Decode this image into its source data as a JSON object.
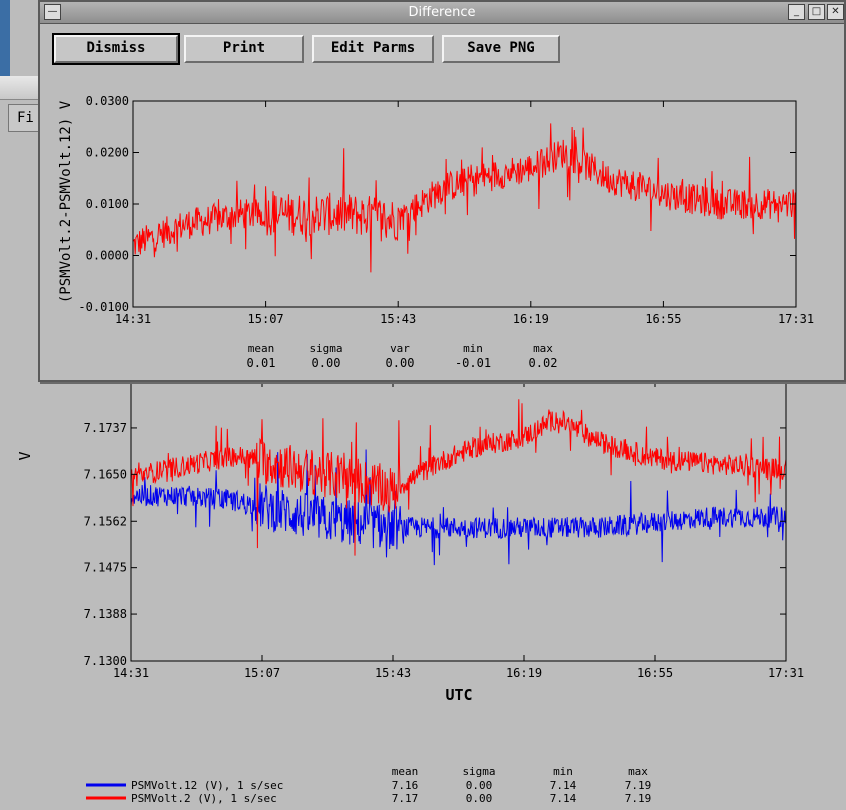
{
  "window": {
    "title": "Difference"
  },
  "background_window": {
    "menu_label": "Fi"
  },
  "toolbar": {
    "dismiss_label": "Dismiss",
    "print_label": "Print",
    "edit_parms_label": "Edit Parms",
    "save_png_label": "Save PNG"
  },
  "diff_plot": {
    "ylabel": "(PSMVolt.2-PSMVolt.12) V",
    "stats_headers": [
      "mean",
      "sigma",
      "var",
      "min",
      "max"
    ],
    "stats_values": [
      "0.01",
      "0.00",
      "0.00",
      "-0.01",
      "0.02"
    ]
  },
  "main_plot": {
    "ylabel": "V",
    "xlabel": "UTC",
    "stats_headers": [
      "mean",
      "sigma",
      "min",
      "max"
    ],
    "legend": [
      {
        "label": "PSMVolt.12 (V), 1 s/sec",
        "color": "#0000ee",
        "mean": "7.16",
        "sigma": "0.00",
        "min": "7.14",
        "max": "7.19"
      },
      {
        "label": "PSMVolt.2 (V), 1 s/sec",
        "color": "#ff0000",
        "mean": "7.17",
        "sigma": "0.00",
        "min": "7.14",
        "max": "7.19"
      }
    ]
  },
  "chart_data": [
    {
      "type": "line",
      "ylabel": "(PSMVolt.2-PSMVolt.12) V",
      "xlabel": "",
      "x_ticks": [
        "14:31",
        "15:07",
        "15:43",
        "16:19",
        "16:55",
        "17:31"
      ],
      "y_ticks": [
        "-0.0100",
        "0.0000",
        "0.0100",
        "0.0200",
        "0.0300"
      ],
      "ylim": [
        -0.01,
        0.03
      ],
      "grid": false,
      "series": [
        {
          "color": "#ff0000",
          "x": [
            "14:31",
            "14:45",
            "15:00",
            "15:07",
            "15:20",
            "15:30",
            "15:43",
            "15:55",
            "16:05",
            "16:19",
            "16:28",
            "16:40",
            "16:55",
            "17:10",
            "17:31"
          ],
          "values": [
            0.002,
            0.006,
            0.008,
            0.008,
            0.008,
            0.008,
            0.007,
            0.013,
            0.015,
            0.017,
            0.02,
            0.015,
            0.012,
            0.01,
            0.01
          ]
        }
      ]
    },
    {
      "type": "line",
      "ylabel": "V",
      "xlabel": "UTC",
      "x_ticks": [
        "14:31",
        "15:07",
        "15:43",
        "16:19",
        "16:55",
        "17:31"
      ],
      "y_ticks": [
        "7.1300",
        "7.1388",
        "7.1475",
        "7.1562",
        "7.1650",
        "7.1737"
      ],
      "ylim": [
        7.13,
        7.1825
      ],
      "grid": false,
      "legend": "bottom-left",
      "series": [
        {
          "name": "PSMVolt.12 (V), 1 s/sec",
          "color": "#0000ee",
          "x": [
            "14:31",
            "14:45",
            "15:00",
            "15:07",
            "15:20",
            "15:30",
            "15:43",
            "15:55",
            "16:05",
            "16:19",
            "16:28",
            "16:40",
            "16:55",
            "17:10",
            "17:31"
          ],
          "values": [
            7.161,
            7.161,
            7.16,
            7.159,
            7.157,
            7.156,
            7.155,
            7.155,
            7.155,
            7.155,
            7.155,
            7.155,
            7.156,
            7.157,
            7.157
          ]
        },
        {
          "name": "PSMVolt.2 (V), 1 s/sec",
          "color": "#ff0000",
          "x": [
            "14:31",
            "14:45",
            "15:00",
            "15:07",
            "15:20",
            "15:30",
            "15:43",
            "15:55",
            "16:05",
            "16:19",
            "16:28",
            "16:40",
            "16:55",
            "17:10",
            "17:31"
          ],
          "values": [
            7.1645,
            7.1665,
            7.1685,
            7.1675,
            7.1655,
            7.1645,
            7.162,
            7.167,
            7.17,
            7.172,
            7.1755,
            7.171,
            7.168,
            7.167,
            7.166
          ]
        }
      ]
    }
  ]
}
